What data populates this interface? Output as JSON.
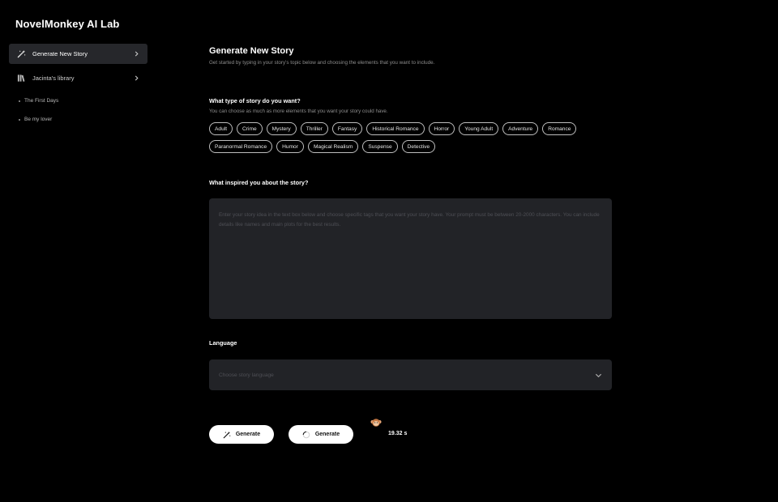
{
  "app": {
    "title": "NovelMonkey AI Lab"
  },
  "sidebar": {
    "items": [
      {
        "label": "Generate New Story",
        "icon": "magic-wand-icon",
        "active": true
      },
      {
        "label": "Jacinta's library",
        "icon": "library-icon",
        "active": false
      }
    ],
    "library_items": [
      "The First Days",
      "Be my lover"
    ]
  },
  "main": {
    "title": "Generate New Story",
    "subtitle": "Get started by typing in your story's topic below and choosing the elements that you want to include.",
    "story_type": {
      "heading": "What type of story do you want?",
      "hint": "You can choose as much as more elements that you want your story could have.",
      "tags": [
        "Adult",
        "Crime",
        "Mystery",
        "Thriller",
        "Fantasy",
        "Historical Romance",
        "Horror",
        "Young Adult",
        "Adventure",
        "Romance",
        "Paranormal Romance",
        "Humor",
        "Magical Realism",
        "Suspense",
        "Detective"
      ]
    },
    "inspiration": {
      "heading": "What inspired you about the story?",
      "placeholder": "Enter your story idea in the text box below and choose specific tags that you want your story have. Your prompt must be between 20-2000 characters. You can include details like names and main plots for the best results.",
      "value": ""
    },
    "language": {
      "heading": "Language",
      "placeholder": "Choose story language"
    },
    "actions": {
      "generate_label": "Generate",
      "loading_label": "Generate",
      "timer": "19.32 s"
    }
  },
  "colors": {
    "background": "#000000",
    "sidebar_active": "#26272b",
    "input_background": "#222327",
    "button": "#ffffff",
    "muted_text": "#8d8d8d"
  }
}
